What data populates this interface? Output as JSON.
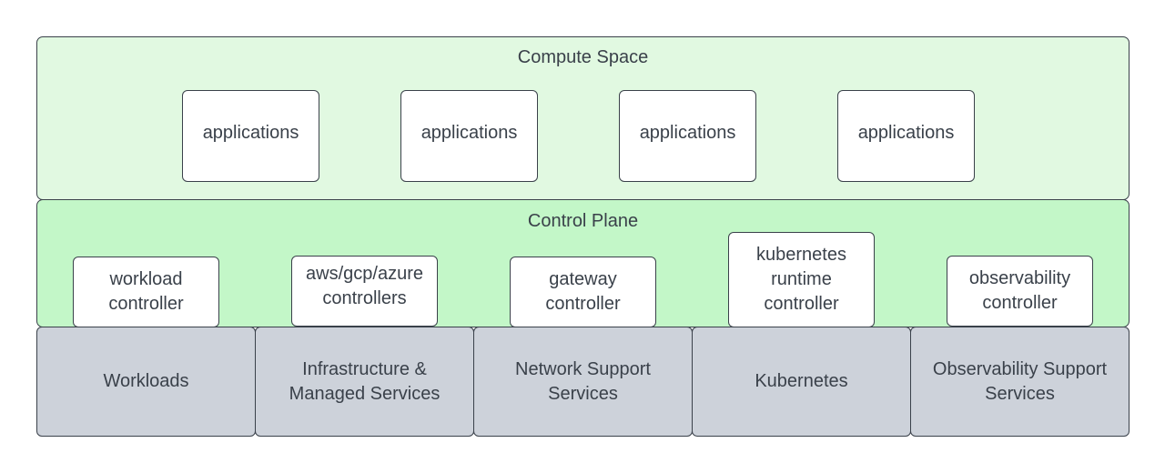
{
  "compute_space": {
    "title": "Compute Space",
    "applications": [
      "applications",
      "applications",
      "applications",
      "applications"
    ]
  },
  "control_plane": {
    "title": "Control Plane",
    "controllers": [
      "workload\ncontroller",
      "aws/gcp/azure\ncontrollers",
      "gateway\ncontroller",
      "kubernetes\nruntime\ncontroller",
      "observability\ncontroller"
    ]
  },
  "support_layer": {
    "services": [
      "Workloads",
      "Infrastructure &\nManaged Services",
      "Network Support\nServices",
      "Kubernetes",
      "Observability Support\nServices"
    ]
  },
  "colors": {
    "compute_fill": "#e1f9e1",
    "control_fill": "#c3f7c8",
    "service_fill": "#cdd2da",
    "stroke": "#3a414a"
  }
}
